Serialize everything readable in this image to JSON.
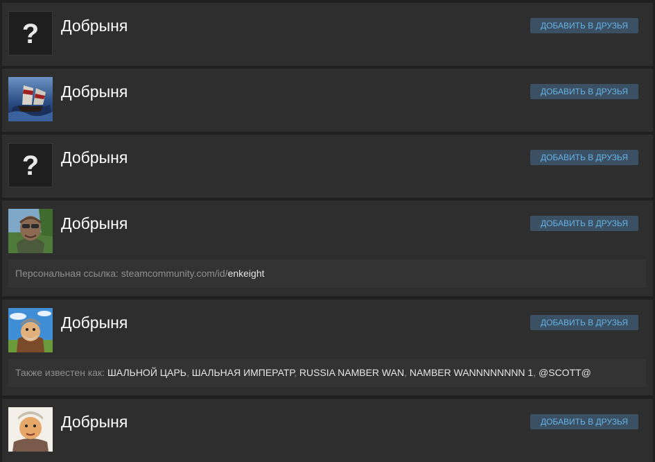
{
  "results": [
    {
      "name": "Добрыня",
      "button": "ДОБАВИТЬ В ДРУЗЬЯ",
      "avatar": "question-mark-icon"
    },
    {
      "name": "Добрыня",
      "button": "ДОБАВИТЬ В ДРУЗЬЯ",
      "avatar": "ship-avatar"
    },
    {
      "name": "Добрыня",
      "button": "ДОБАВИТЬ В ДРУЗЬЯ",
      "avatar": "question-mark-icon"
    },
    {
      "name": "Добрыня",
      "button": "ДОБАВИТЬ В ДРУЗЬЯ",
      "avatar": "old-man-avatar",
      "info_label": "Персональная ссылка: ",
      "info_prefix": "steamcommunity.com/id/",
      "info_value": "enkeight"
    },
    {
      "name": "Добрыня",
      "button": "ДОБАВИТЬ В ДРУЗЬЯ",
      "avatar": "cartoon-bogatyr-avatar",
      "info_label": "Также известен как: ",
      "aliases": [
        "ШАЛЬНОЙ ЦАРЬ",
        "ШАЛЬНАЯ ИМПЕРАТР",
        "RUSSIA NAMBER WAN",
        "NAMBER WANNNNNNNN 1",
        "@SCOTT@"
      ]
    },
    {
      "name": "Добрыня",
      "button": "ДОБАВИТЬ В ДРУЗЬЯ",
      "avatar": "cartoon-bogatyr-avatar"
    }
  ]
}
